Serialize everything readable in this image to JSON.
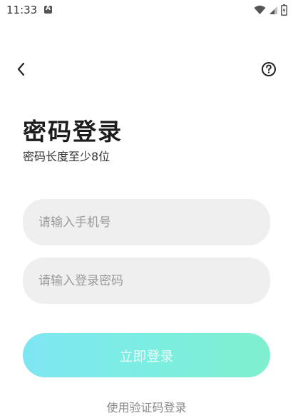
{
  "status": {
    "time": "11:33"
  },
  "header": {
    "back_icon": "chevron-left-icon",
    "help_icon": "help-circle-icon"
  },
  "title": "密码登录",
  "subtitle": "密码长度至少8位",
  "form": {
    "phone_placeholder": "请输入手机号",
    "phone_value": "",
    "password_placeholder": "请输入登录密码",
    "password_value": ""
  },
  "login_button": {
    "label": "立即登录"
  },
  "alt_login": {
    "label": "使用验证码登录"
  },
  "colors": {
    "button_gradient_start": "#7ee6f2",
    "button_gradient_end": "#80efce",
    "field_bg": "#efefef"
  }
}
